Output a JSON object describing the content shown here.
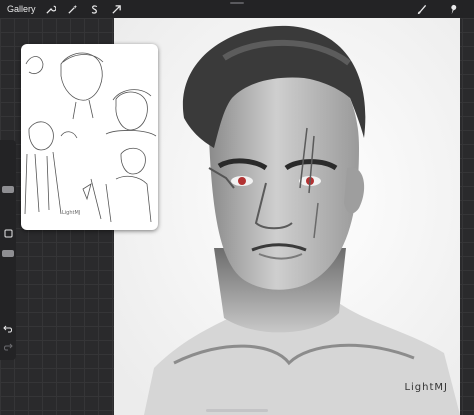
{
  "toolbar": {
    "gallery_label": "Gallery",
    "left_tools": [
      "wrench-icon",
      "magic-wand-icon",
      "selection-icon",
      "transform-arrow-icon"
    ],
    "right_tools": [
      "brush-icon",
      "smudge-icon"
    ]
  },
  "canvas": {
    "signature": "LightMJ"
  },
  "reference": {
    "signature": "LightMJ"
  },
  "sidebar": {
    "items": [
      "brush-size-slider",
      "modify-button",
      "opacity-slider",
      "undo-button",
      "redo-button"
    ]
  },
  "colors": {
    "toolbar_bg": "#232325",
    "canvas_bg": "#2a2a2c",
    "text": "#e9e9ea"
  }
}
